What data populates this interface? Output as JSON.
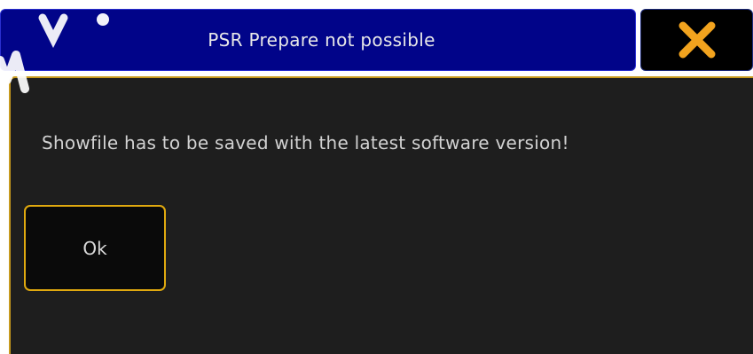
{
  "dialog": {
    "title": "PSR Prepare not possible",
    "message": "Showfile has to be saved with the latest software version!",
    "ok_label": "Ok",
    "close_icon": "close-x-icon"
  },
  "colors": {
    "titlebar_bg": "#010489",
    "body_bg": "#1e1e1e",
    "accent_border": "#e0a90f",
    "close_icon": "#f2a31e"
  }
}
